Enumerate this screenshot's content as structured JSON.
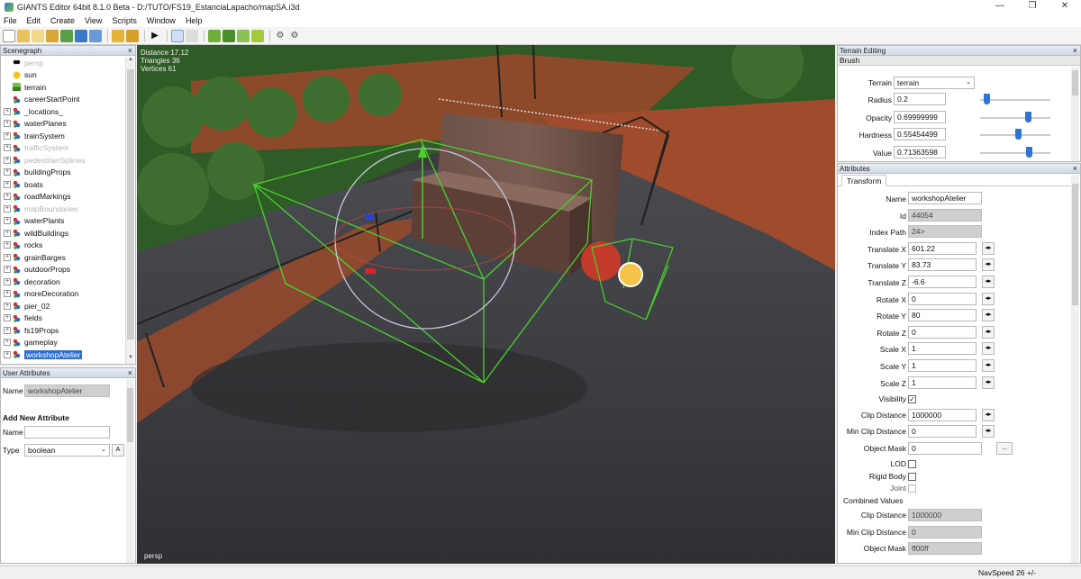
{
  "window": {
    "title": "GIANTS Editor 64bit 8.1.0 Beta - D:/TUTO/FS19_EstanciaLapacho/mapSA.i3d",
    "minimize": "—",
    "maximize": "❐",
    "close": "✕"
  },
  "menu": [
    "File",
    "Edit",
    "Create",
    "View",
    "Scripts",
    "Window",
    "Help"
  ],
  "scenegraph": {
    "title": "Scenegraph",
    "items": [
      {
        "label": "persp",
        "icon": "camera-icon",
        "faded": true,
        "expandable": false
      },
      {
        "label": "sun",
        "icon": "sun-icon",
        "faded": false,
        "expandable": false
      },
      {
        "label": "terrain",
        "icon": "terrain-icon",
        "faded": false,
        "expandable": false
      },
      {
        "label": "careerStartPoint",
        "icon": "transformgroup-icon",
        "faded": false,
        "expandable": false
      },
      {
        "label": "_locations_",
        "icon": "transformgroup-icon",
        "faded": false,
        "expandable": true
      },
      {
        "label": "waterPlanes",
        "icon": "transformgroup-icon",
        "faded": false,
        "expandable": true
      },
      {
        "label": "trainSystem",
        "icon": "transformgroup-icon",
        "faded": false,
        "expandable": true
      },
      {
        "label": "trafficSystem",
        "icon": "transformgroup-icon",
        "faded": true,
        "expandable": true
      },
      {
        "label": "pedestrianSplines",
        "icon": "transformgroup-icon",
        "faded": true,
        "expandable": true
      },
      {
        "label": "buildingProps",
        "icon": "transformgroup-icon",
        "faded": false,
        "expandable": true
      },
      {
        "label": "boats",
        "icon": "transformgroup-icon",
        "faded": false,
        "expandable": true
      },
      {
        "label": "roadMarkings",
        "icon": "transformgroup-icon",
        "faded": false,
        "expandable": true
      },
      {
        "label": "mapBoundaries",
        "icon": "transformgroup-icon",
        "faded": true,
        "expandable": true
      },
      {
        "label": "waterPlants",
        "icon": "transformgroup-icon",
        "faded": false,
        "expandable": true
      },
      {
        "label": "wildBuildings",
        "icon": "transformgroup-icon",
        "faded": false,
        "expandable": true
      },
      {
        "label": "rocks",
        "icon": "transformgroup-icon",
        "faded": false,
        "expandable": true
      },
      {
        "label": "grainBarges",
        "icon": "transformgroup-icon",
        "faded": false,
        "expandable": true
      },
      {
        "label": "outdoorProps",
        "icon": "transformgroup-icon",
        "faded": false,
        "expandable": true
      },
      {
        "label": "decoration",
        "icon": "transformgroup-icon",
        "faded": false,
        "expandable": true
      },
      {
        "label": "moreDecoration",
        "icon": "transformgroup-icon",
        "faded": false,
        "expandable": true
      },
      {
        "label": "pier_02",
        "icon": "transformgroup-icon",
        "faded": false,
        "expandable": true
      },
      {
        "label": "fields",
        "icon": "transformgroup-icon",
        "faded": false,
        "expandable": true
      },
      {
        "label": "fs19Props",
        "icon": "transformgroup-icon",
        "faded": false,
        "expandable": true
      },
      {
        "label": "gameplay",
        "icon": "transformgroup-icon",
        "faded": false,
        "expandable": true
      },
      {
        "label": "workshopAtelier",
        "icon": "transformgroup-icon",
        "faded": false,
        "expandable": true,
        "selected": true
      }
    ]
  },
  "user_attributes": {
    "title": "User Attributes",
    "name_label": "Name",
    "name_value": "workshopAtelier",
    "add_title": "Add New Attribute",
    "new_name_label": "Name",
    "new_name_value": "",
    "type_label": "Type",
    "type_value": "boolean",
    "add_button": "A"
  },
  "viewport": {
    "info": [
      "Distance 17.12",
      "Triangles 36",
      "Vertices 61"
    ],
    "camera": "persp"
  },
  "terrain_editing": {
    "title": "Terrain Editing",
    "section": "Brush",
    "terrain_label": "Terrain",
    "terrain_value": "terrain",
    "rows": [
      {
        "label": "Radius",
        "value": "0.2",
        "level": 0.05
      },
      {
        "label": "Opacity",
        "value": "0.69999999",
        "level": 0.7
      },
      {
        "label": "Hardness",
        "value": "0.55454499",
        "level": 0.555
      },
      {
        "label": "Value",
        "value": "0.71363598",
        "level": 0.714
      }
    ]
  },
  "attributes": {
    "title": "Attributes",
    "tab": "Transform",
    "rows": [
      {
        "label": "Name",
        "value": "workshopAtelier",
        "ro": false,
        "btn": false
      },
      {
        "label": "Id",
        "value": "44054",
        "ro": true,
        "btn": false
      },
      {
        "label": "Index Path",
        "value": "24>",
        "ro": true,
        "btn": false
      },
      {
        "label": "Translate X",
        "value": "601.22",
        "ro": false,
        "btn": true
      },
      {
        "label": "Translate Y",
        "value": "83.73",
        "ro": false,
        "btn": true
      },
      {
        "label": "Translate Z",
        "value": "-6.6",
        "ro": false,
        "btn": true
      },
      {
        "label": "Rotate X",
        "value": "0",
        "ro": false,
        "btn": true
      },
      {
        "label": "Rotate Y",
        "value": "80",
        "ro": false,
        "btn": true
      },
      {
        "label": "Rotate Z",
        "value": "0",
        "ro": false,
        "btn": true
      },
      {
        "label": "Scale X",
        "value": "1",
        "ro": false,
        "btn": true
      },
      {
        "label": "Scale Y",
        "value": "1",
        "ro": false,
        "btn": true
      },
      {
        "label": "Scale Z",
        "value": "1",
        "ro": false,
        "btn": true
      }
    ],
    "visibility_label": "Visibility",
    "clip_label": "Clip Distance",
    "clip_value": "1000000",
    "minclip_label": "Min Clip Distance",
    "minclip_value": "0",
    "mask_label": "Object Mask",
    "mask_value": "0",
    "mask_btn": "...",
    "lod_label": "LOD",
    "rigid_label": "Rigid Body",
    "joint_label": "Joint",
    "combined_label": "Combined Values",
    "c_clip_label": "Clip Distance",
    "c_clip_value": "1000000",
    "c_minclip_label": "Min Clip Distance",
    "c_minclip_value": "0",
    "c_mask_label": "Object Mask",
    "c_mask_value": "ff00ff"
  },
  "status": {
    "navspeed": "NavSpeed 26 +/-"
  }
}
